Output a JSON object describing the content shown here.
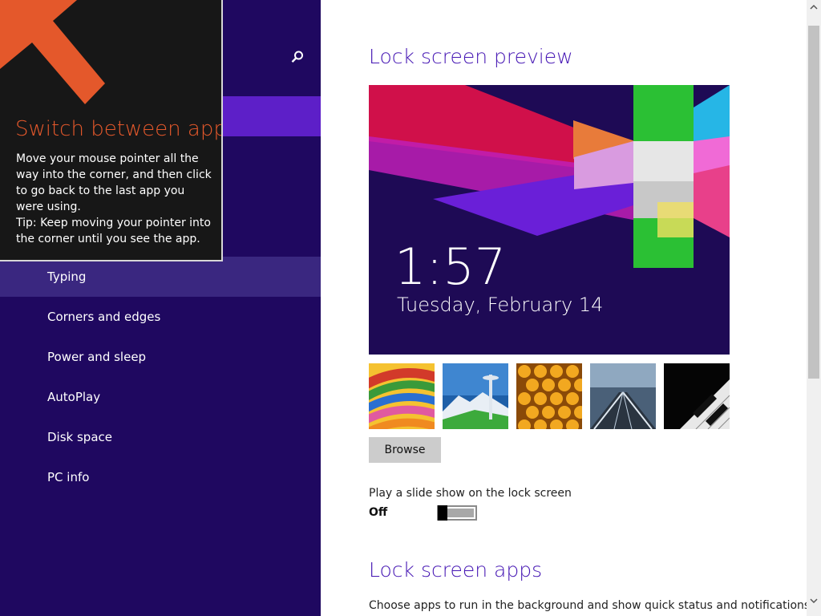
{
  "tip": {
    "title": "Switch between apps",
    "body_main": "Move your mouse pointer all the way into the corner, and then click to go back to the last app you were using.",
    "body_tip": "Tip: Keep moving your pointer into the corner until you see the app.",
    "accent_color": "#e4582b"
  },
  "sidebar": {
    "search_icon": "search-icon",
    "items": [
      {
        "label": "Typing",
        "active": true
      },
      {
        "label": "Corners and edges"
      },
      {
        "label": "Power and sleep"
      },
      {
        "label": "AutoPlay"
      },
      {
        "label": "Disk space"
      },
      {
        "label": "PC info"
      }
    ]
  },
  "lock_screen": {
    "preview_title": "Lock screen preview",
    "time": "1:57",
    "date": "Tuesday, February 14",
    "thumbnails": [
      "colorful-ribbons-image",
      "seattle-space-needle-image",
      "honeycomb-image",
      "light-trails-image",
      "piano-keys-image"
    ],
    "browse_label": "Browse",
    "slideshow_label": "Play a slide show on the lock screen",
    "slideshow_state": "Off",
    "slideshow_on": false
  },
  "lock_screen_apps": {
    "title": "Lock screen apps",
    "description": "Choose apps to run in the background and show quick status and notifications,"
  },
  "colors": {
    "sidebar_bg": "#1f0860",
    "heading": "#4617b4",
    "selected_bar": "#5d1fc8"
  }
}
